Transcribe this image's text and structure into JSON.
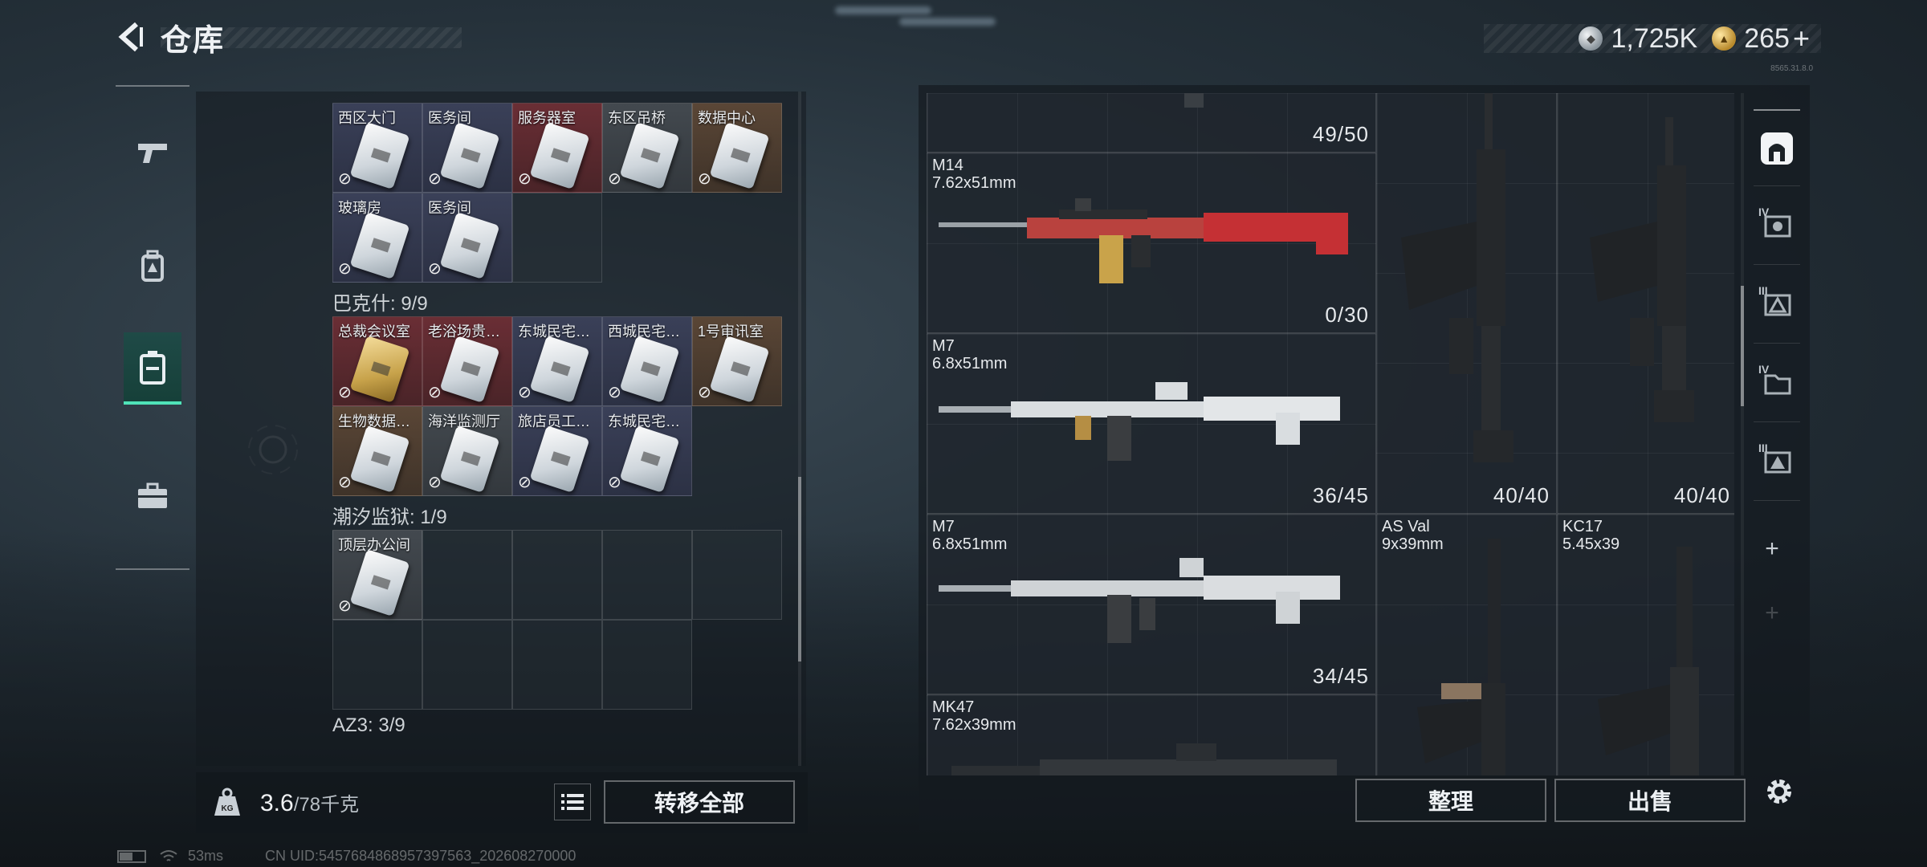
{
  "header": {
    "title": "仓库"
  },
  "currency": {
    "silver_amount": "1,725K",
    "gold_amount": "265",
    "gold_plus": "+",
    "small_code": "8565.31.8.0"
  },
  "left": {
    "sections": [
      {
        "title": "",
        "cards": [
          {
            "label": "西区大门",
            "color": "blue"
          },
          {
            "label": "医务间",
            "color": "blue"
          },
          {
            "label": "服务器室",
            "color": "red"
          },
          {
            "label": "东区吊桥",
            "color": "gray"
          },
          {
            "label": "数据中心",
            "color": "brown"
          },
          {
            "label": "玻璃房",
            "color": "blue"
          },
          {
            "label": "医务间",
            "color": "blue"
          }
        ],
        "total_cells": 8
      },
      {
        "title": "巴克什: 9/9",
        "cards": [
          {
            "label": "总裁会议室",
            "color": "red",
            "gold": true
          },
          {
            "label": "老浴场贵…",
            "color": "red"
          },
          {
            "label": "东城民宅…",
            "color": "blue"
          },
          {
            "label": "西城民宅…",
            "color": "blue"
          },
          {
            "label": "1号审讯室",
            "color": "brown"
          },
          {
            "label": "生物数据…",
            "color": "brown"
          },
          {
            "label": "海洋监测厅",
            "color": "gray"
          },
          {
            "label": "旅店员工…",
            "color": "blue"
          },
          {
            "label": "东城民宅…",
            "color": "blue"
          }
        ],
        "total_cells": 9
      },
      {
        "title": "潮汐监狱: 1/9",
        "cards": [
          {
            "label": "顶层办公间",
            "color": "gray"
          }
        ],
        "total_cells": 9
      },
      {
        "title": "AZ3: 3/9",
        "cards": [],
        "total_cells": 0
      }
    ],
    "nobind_icon": "no-bind-icon",
    "weight_current": "3.6",
    "weight_max": "/78千克",
    "transfer_all": "转移全部"
  },
  "weapons": [
    {
      "name": "",
      "caliber": "",
      "count": "49/50"
    },
    {
      "name": "M14",
      "caliber": "7.62x51mm",
      "count": "0/30"
    },
    {
      "name": "M7",
      "caliber": "6.8x51mm",
      "count": "36/45"
    },
    {
      "name": "M7",
      "caliber": "6.8x51mm",
      "count": "34/45"
    },
    {
      "name": "MK47",
      "caliber": "7.62x39mm",
      "count": ""
    },
    {
      "name": "",
      "caliber": "",
      "count": "40/40"
    },
    {
      "name": "",
      "caliber": "",
      "count": "40/40"
    },
    {
      "name": "AS Val",
      "caliber": "9x39mm",
      "count": ""
    },
    {
      "name": "KC17",
      "caliber": "5.45x39",
      "count": ""
    }
  ],
  "side_tabs": [
    {
      "icon": "all-items-icon",
      "roman": ""
    },
    {
      "icon": "tier4-attachment-icon",
      "roman": "IV"
    },
    {
      "icon": "tier3-ammo-icon",
      "roman": "III"
    },
    {
      "icon": "tier4-folder-icon",
      "roman": "IV"
    },
    {
      "icon": "tier3-warning-icon",
      "roman": "III"
    }
  ],
  "actions": {
    "organize": "整理",
    "sell": "出售"
  },
  "status": {
    "ping": "53ms",
    "uid": "CN UID:5457684868957397563_202608270000"
  },
  "colors": {
    "accent": "#4fe3b8"
  }
}
